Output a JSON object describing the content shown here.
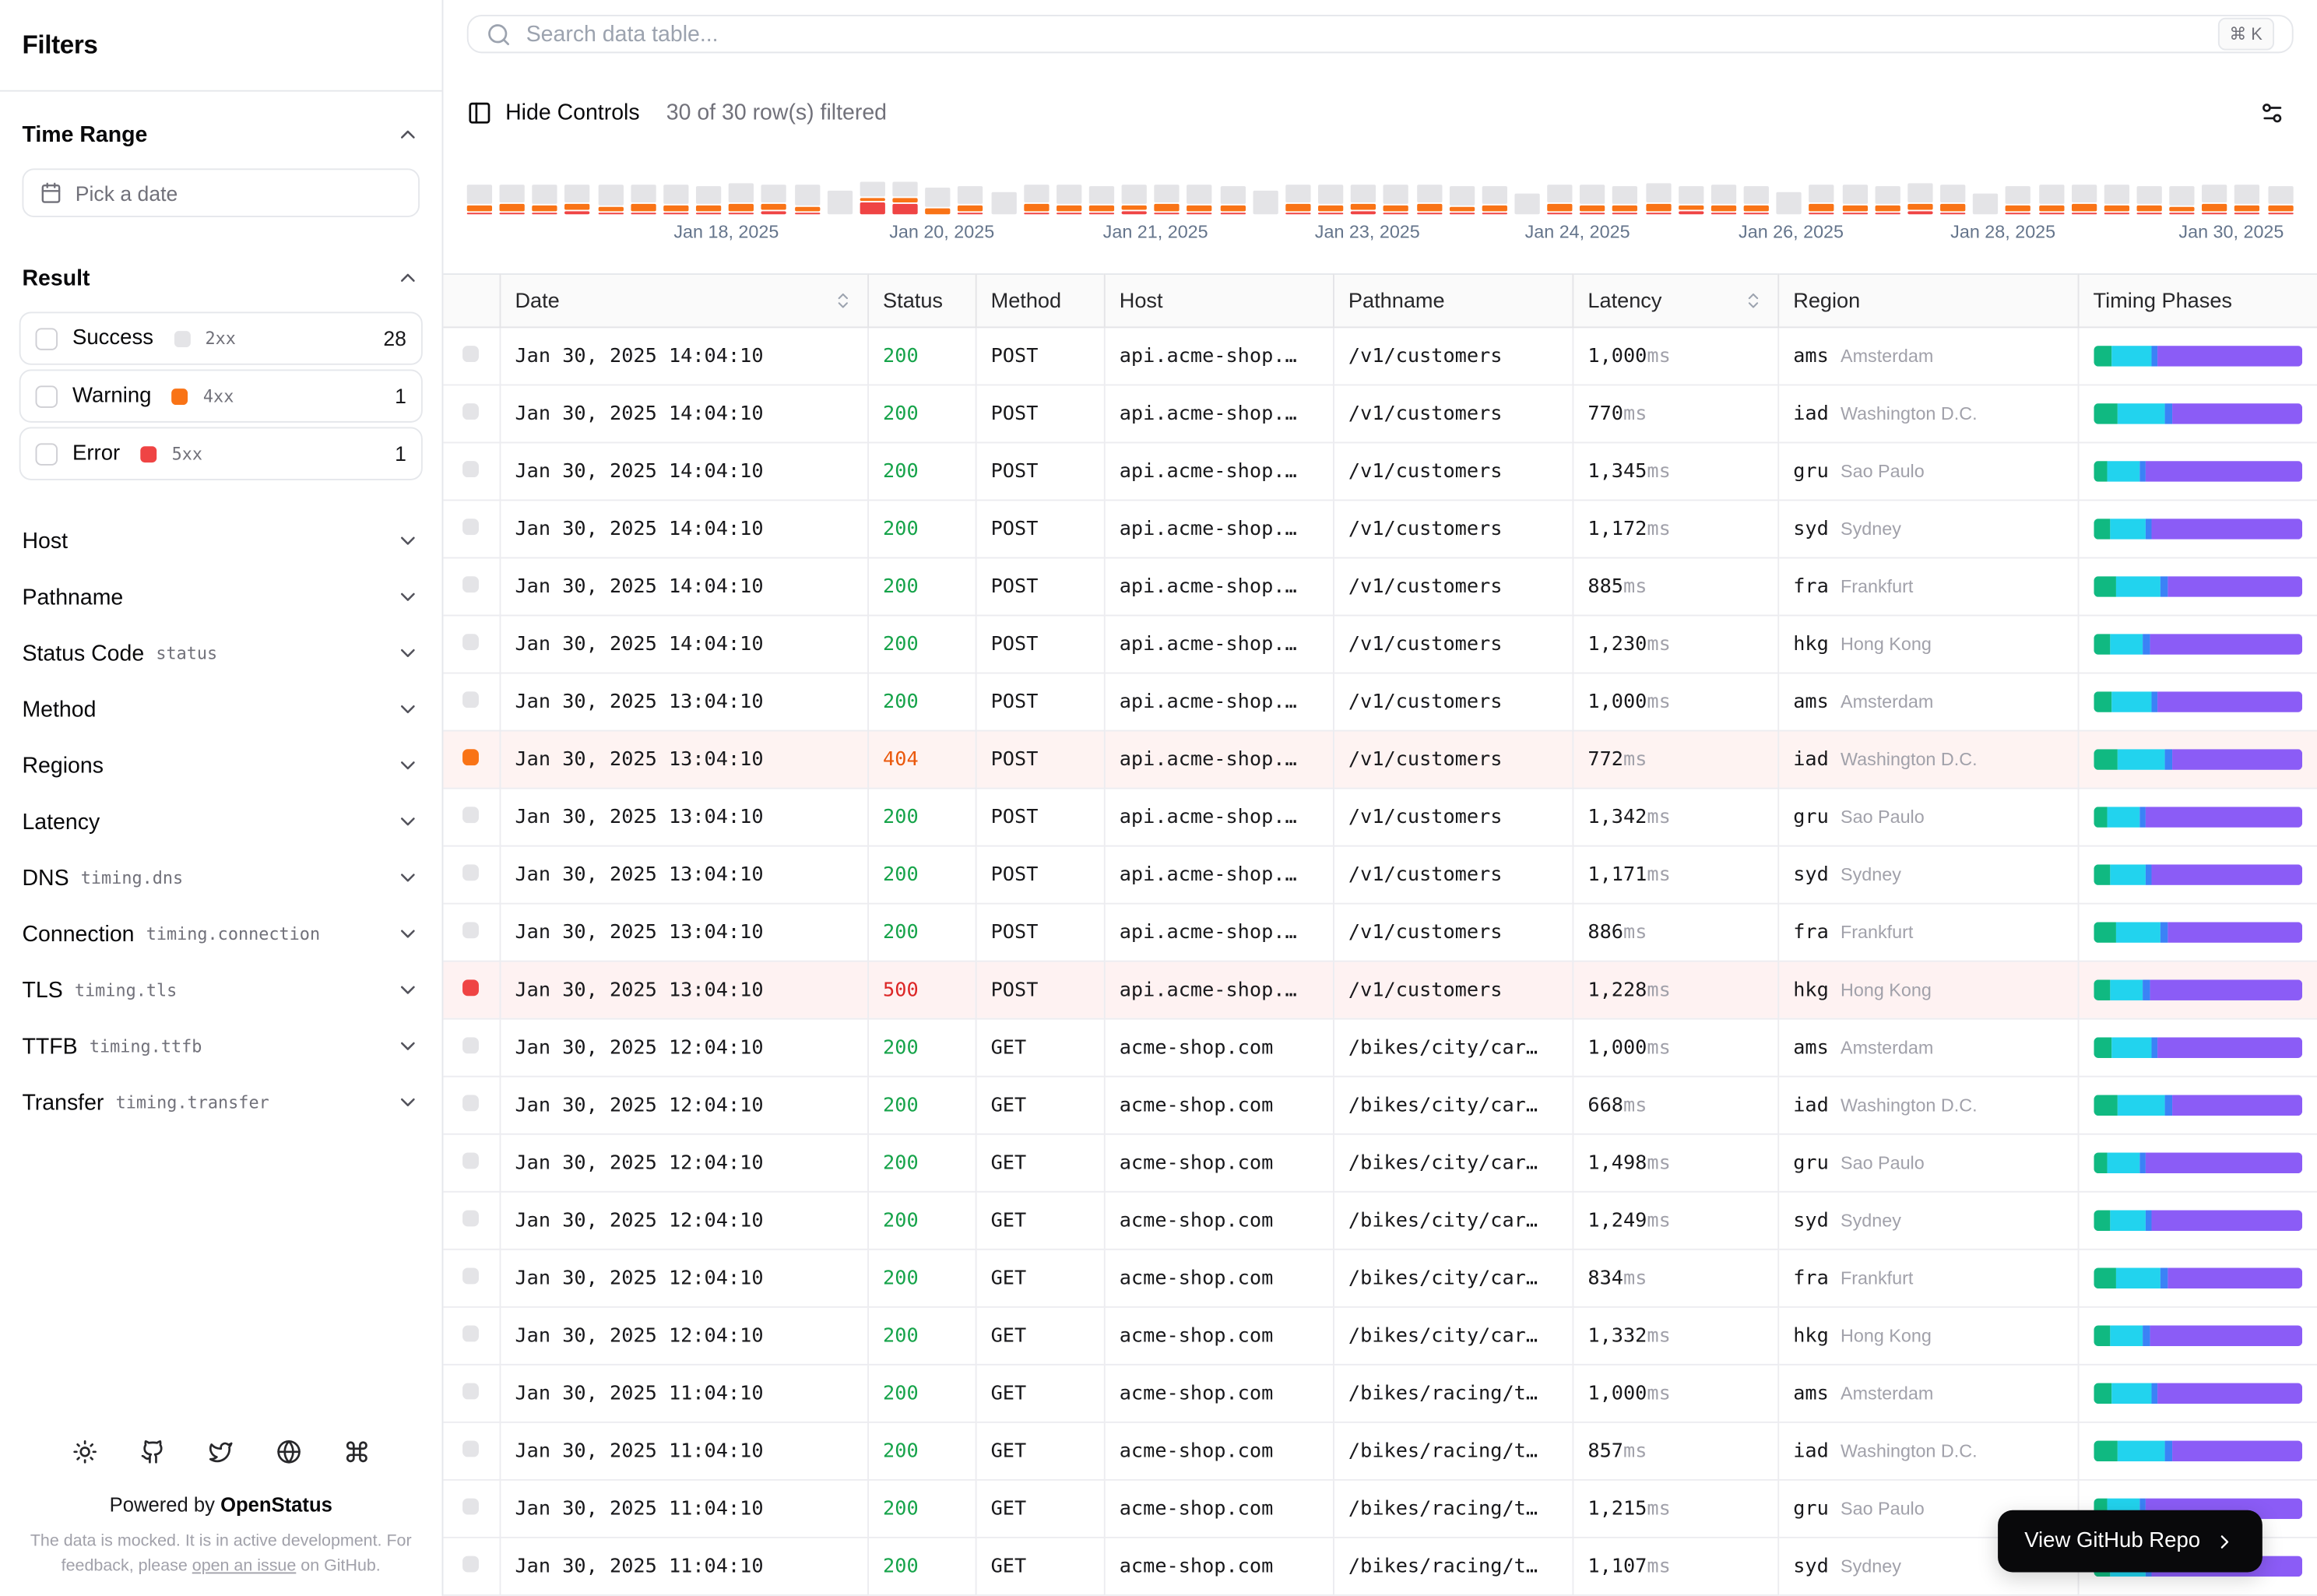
{
  "sidebar": {
    "title": "Filters",
    "time_range": {
      "label": "Time Range",
      "placeholder": "Pick a date"
    },
    "result": {
      "label": "Result",
      "options": [
        {
          "label": "Success",
          "code": "2xx",
          "count": "28",
          "color": "#e4e4e7"
        },
        {
          "label": "Warning",
          "code": "4xx",
          "count": "1",
          "color": "#f97316"
        },
        {
          "label": "Error",
          "code": "5xx",
          "count": "1",
          "color": "#ef4444"
        }
      ]
    },
    "collapsed_sections": [
      {
        "label": "Host",
        "code": ""
      },
      {
        "label": "Pathname",
        "code": ""
      },
      {
        "label": "Status Code",
        "code": "status"
      },
      {
        "label": "Method",
        "code": ""
      },
      {
        "label": "Regions",
        "code": ""
      },
      {
        "label": "Latency",
        "code": ""
      },
      {
        "label": "DNS",
        "code": "timing.dns"
      },
      {
        "label": "Connection",
        "code": "timing.connection"
      },
      {
        "label": "TLS",
        "code": "timing.tls"
      },
      {
        "label": "TTFB",
        "code": "timing.ttfb"
      },
      {
        "label": "Transfer",
        "code": "timing.transfer"
      }
    ],
    "footer": {
      "icons": [
        "sun-icon",
        "github-icon",
        "twitter-icon",
        "globe-icon",
        "command-icon"
      ],
      "powered_prefix": "Powered by ",
      "powered_link": "OpenStatus",
      "note_line1": "The data is mocked. It is in active development. For",
      "note_line2_prefix": "feedback, please ",
      "note_line2_link": "open an issue",
      "note_line2_suffix": " on GitHub."
    }
  },
  "toolbar": {
    "search_placeholder": "Search data table...",
    "kbd": "⌘ K",
    "hide_controls_label": "Hide Controls",
    "filtered_text": "30 of 30 row(s) filtered"
  },
  "chart_data": {
    "type": "bar",
    "stacked": true,
    "note": "request volume per time bucket; segment heights in px as rendered",
    "series_names": [
      "success",
      "warning",
      "error"
    ],
    "series_colors": {
      "success": "#e4e4e7",
      "warning": "#f97316",
      "error": "#ef4444"
    },
    "x_labels": [
      "Jan 18, 2025",
      "Jan 20, 2025",
      "Jan 21, 2025",
      "Jan 23, 2025",
      "Jan 24, 2025",
      "Jan 26, 2025",
      "Jan 28, 2025",
      "Jan 30, 2025"
    ],
    "x_label_positions_pct": [
      14.2,
      26.0,
      37.7,
      49.3,
      60.8,
      72.5,
      84.1,
      96.6
    ],
    "bars": [
      [
        13,
        4,
        1
      ],
      [
        12,
        5,
        1
      ],
      [
        13,
        4,
        1
      ],
      [
        12,
        4,
        2
      ],
      [
        14,
        3,
        1
      ],
      [
        12,
        5,
        1
      ],
      [
        13,
        4,
        1
      ],
      [
        12,
        4,
        1
      ],
      [
        13,
        5,
        1
      ],
      [
        12,
        4,
        2
      ],
      [
        14,
        3,
        1
      ],
      [
        16,
        0,
        0
      ],
      [
        10,
        2,
        8
      ],
      [
        10,
        3,
        7
      ],
      [
        13,
        4,
        0
      ],
      [
        12,
        4,
        1
      ],
      [
        15,
        0,
        0
      ],
      [
        12,
        5,
        1
      ],
      [
        13,
        4,
        1
      ],
      [
        12,
        4,
        1
      ],
      [
        13,
        3,
        2
      ],
      [
        12,
        5,
        1
      ],
      [
        13,
        4,
        1
      ],
      [
        12,
        4,
        1
      ],
      [
        16,
        0,
        0
      ],
      [
        12,
        5,
        1
      ],
      [
        13,
        4,
        1
      ],
      [
        12,
        4,
        2
      ],
      [
        13,
        4,
        1
      ],
      [
        12,
        5,
        1
      ],
      [
        13,
        3,
        1
      ],
      [
        12,
        4,
        1
      ],
      [
        14,
        0,
        0
      ],
      [
        12,
        5,
        1
      ],
      [
        13,
        4,
        1
      ],
      [
        12,
        4,
        1
      ],
      [
        13,
        5,
        1
      ],
      [
        12,
        3,
        2
      ],
      [
        13,
        4,
        1
      ],
      [
        12,
        4,
        1
      ],
      [
        15,
        0,
        0
      ],
      [
        12,
        5,
        1
      ],
      [
        13,
        4,
        1
      ],
      [
        12,
        4,
        1
      ],
      [
        13,
        4,
        2
      ],
      [
        12,
        5,
        1
      ],
      [
        14,
        0,
        0
      ],
      [
        12,
        4,
        1
      ],
      [
        13,
        4,
        1
      ],
      [
        12,
        5,
        1
      ],
      [
        13,
        4,
        1
      ],
      [
        12,
        4,
        1
      ],
      [
        13,
        3,
        1
      ],
      [
        12,
        5,
        1
      ],
      [
        13,
        4,
        1
      ],
      [
        12,
        4,
        1
      ]
    ]
  },
  "table": {
    "columns": [
      {
        "label": "",
        "key": "select",
        "sortable": false
      },
      {
        "label": "Date",
        "key": "date",
        "sortable": true
      },
      {
        "label": "Status",
        "key": "status",
        "sortable": false
      },
      {
        "label": "Method",
        "key": "method",
        "sortable": false
      },
      {
        "label": "Host",
        "key": "host",
        "sortable": false
      },
      {
        "label": "Pathname",
        "key": "pathname",
        "sortable": false
      },
      {
        "label": "Latency",
        "key": "latency",
        "sortable": true
      },
      {
        "label": "Region",
        "key": "region",
        "sortable": false
      },
      {
        "label": "Timing Phases",
        "key": "timing",
        "sortable": false
      }
    ],
    "status_colors": {
      "200": "#16a34a",
      "404": "#ea580c",
      "500": "#dc2626"
    },
    "level_colors": {
      "success": "#e4e4e7",
      "warning": "#f97316",
      "error": "#ef4444"
    },
    "timing_colors": [
      "#10b981",
      "#22d3ee",
      "#3b82f6",
      "#8b5cf6"
    ],
    "timing_phase_names": [
      "dns",
      "connection",
      "tls",
      "ttfb"
    ],
    "rows": [
      {
        "date": "Jan 30, 2025 14:04:10",
        "status": "200",
        "method": "POST",
        "host": "api.acme-shop.…",
        "path": "/v1/customers",
        "latency": "1,000",
        "region": "ams",
        "city": "Amsterdam",
        "level": "success",
        "timing": [
          9,
          19,
          3,
          69
        ]
      },
      {
        "date": "Jan 30, 2025 14:04:10",
        "status": "200",
        "method": "POST",
        "host": "api.acme-shop.…",
        "path": "/v1/customers",
        "latency": "770",
        "region": "iad",
        "city": "Washington D.C.",
        "level": "success",
        "timing": [
          12,
          22,
          4,
          62
        ]
      },
      {
        "date": "Jan 30, 2025 14:04:10",
        "status": "200",
        "method": "POST",
        "host": "api.acme-shop.…",
        "path": "/v1/customers",
        "latency": "1,345",
        "region": "gru",
        "city": "Sao Paulo",
        "level": "success",
        "timing": [
          7,
          15,
          3,
          75
        ]
      },
      {
        "date": "Jan 30, 2025 14:04:10",
        "status": "200",
        "method": "POST",
        "host": "api.acme-shop.…",
        "path": "/v1/customers",
        "latency": "1,172",
        "region": "syd",
        "city": "Sydney",
        "level": "success",
        "timing": [
          8,
          17,
          3,
          72
        ]
      },
      {
        "date": "Jan 30, 2025 14:04:10",
        "status": "200",
        "method": "POST",
        "host": "api.acme-shop.…",
        "path": "/v1/customers",
        "latency": "885",
        "region": "fra",
        "city": "Frankfurt",
        "level": "success",
        "timing": [
          11,
          21,
          4,
          64
        ]
      },
      {
        "date": "Jan 30, 2025 14:04:10",
        "status": "200",
        "method": "POST",
        "host": "api.acme-shop.…",
        "path": "/v1/customers",
        "latency": "1,230",
        "region": "hkg",
        "city": "Hong Kong",
        "level": "success",
        "timing": [
          8,
          16,
          3,
          73
        ]
      },
      {
        "date": "Jan 30, 2025 13:04:10",
        "status": "200",
        "method": "POST",
        "host": "api.acme-shop.…",
        "path": "/v1/customers",
        "latency": "1,000",
        "region": "ams",
        "city": "Amsterdam",
        "level": "success",
        "timing": [
          9,
          19,
          3,
          69
        ]
      },
      {
        "date": "Jan 30, 2025 13:04:10",
        "status": "404",
        "method": "POST",
        "host": "api.acme-shop.…",
        "path": "/v1/customers",
        "latency": "772",
        "region": "iad",
        "city": "Washington D.C.",
        "level": "warning",
        "timing": [
          12,
          22,
          4,
          62
        ]
      },
      {
        "date": "Jan 30, 2025 13:04:10",
        "status": "200",
        "method": "POST",
        "host": "api.acme-shop.…",
        "path": "/v1/customers",
        "latency": "1,342",
        "region": "gru",
        "city": "Sao Paulo",
        "level": "success",
        "timing": [
          7,
          15,
          3,
          75
        ]
      },
      {
        "date": "Jan 30, 2025 13:04:10",
        "status": "200",
        "method": "POST",
        "host": "api.acme-shop.…",
        "path": "/v1/customers",
        "latency": "1,171",
        "region": "syd",
        "city": "Sydney",
        "level": "success",
        "timing": [
          8,
          17,
          3,
          72
        ]
      },
      {
        "date": "Jan 30, 2025 13:04:10",
        "status": "200",
        "method": "POST",
        "host": "api.acme-shop.…",
        "path": "/v1/customers",
        "latency": "886",
        "region": "fra",
        "city": "Frankfurt",
        "level": "success",
        "timing": [
          11,
          21,
          4,
          64
        ]
      },
      {
        "date": "Jan 30, 2025 13:04:10",
        "status": "500",
        "method": "POST",
        "host": "api.acme-shop.…",
        "path": "/v1/customers",
        "latency": "1,228",
        "region": "hkg",
        "city": "Hong Kong",
        "level": "error",
        "timing": [
          8,
          16,
          3,
          73
        ]
      },
      {
        "date": "Jan 30, 2025 12:04:10",
        "status": "200",
        "method": "GET",
        "host": "acme-shop.com",
        "path": "/bikes/city/car…",
        "latency": "1,000",
        "region": "ams",
        "city": "Amsterdam",
        "level": "success",
        "timing": [
          9,
          19,
          3,
          69
        ]
      },
      {
        "date": "Jan 30, 2025 12:04:10",
        "status": "200",
        "method": "GET",
        "host": "acme-shop.com",
        "path": "/bikes/city/car…",
        "latency": "668",
        "region": "iad",
        "city": "Washington D.C.",
        "level": "success",
        "timing": [
          12,
          22,
          4,
          62
        ]
      },
      {
        "date": "Jan 30, 2025 12:04:10",
        "status": "200",
        "method": "GET",
        "host": "acme-shop.com",
        "path": "/bikes/city/car…",
        "latency": "1,498",
        "region": "gru",
        "city": "Sao Paulo",
        "level": "success",
        "timing": [
          7,
          15,
          3,
          75
        ]
      },
      {
        "date": "Jan 30, 2025 12:04:10",
        "status": "200",
        "method": "GET",
        "host": "acme-shop.com",
        "path": "/bikes/city/car…",
        "latency": "1,249",
        "region": "syd",
        "city": "Sydney",
        "level": "success",
        "timing": [
          8,
          17,
          3,
          72
        ]
      },
      {
        "date": "Jan 30, 2025 12:04:10",
        "status": "200",
        "method": "GET",
        "host": "acme-shop.com",
        "path": "/bikes/city/car…",
        "latency": "834",
        "region": "fra",
        "city": "Frankfurt",
        "level": "success",
        "timing": [
          11,
          21,
          4,
          64
        ]
      },
      {
        "date": "Jan 30, 2025 12:04:10",
        "status": "200",
        "method": "GET",
        "host": "acme-shop.com",
        "path": "/bikes/city/car…",
        "latency": "1,332",
        "region": "hkg",
        "city": "Hong Kong",
        "level": "success",
        "timing": [
          8,
          16,
          3,
          73
        ]
      },
      {
        "date": "Jan 30, 2025 11:04:10",
        "status": "200",
        "method": "GET",
        "host": "acme-shop.com",
        "path": "/bikes/racing/t…",
        "latency": "1,000",
        "region": "ams",
        "city": "Amsterdam",
        "level": "success",
        "timing": [
          9,
          19,
          3,
          69
        ]
      },
      {
        "date": "Jan 30, 2025 11:04:10",
        "status": "200",
        "method": "GET",
        "host": "acme-shop.com",
        "path": "/bikes/racing/t…",
        "latency": "857",
        "region": "iad",
        "city": "Washington D.C.",
        "level": "success",
        "timing": [
          12,
          22,
          4,
          62
        ]
      },
      {
        "date": "Jan 30, 2025 11:04:10",
        "status": "200",
        "method": "GET",
        "host": "acme-shop.com",
        "path": "/bikes/racing/t…",
        "latency": "1,215",
        "region": "gru",
        "city": "Sao Paulo",
        "level": "success",
        "timing": [
          7,
          15,
          3,
          75
        ]
      },
      {
        "date": "Jan 30, 2025 11:04:10",
        "status": "200",
        "method": "GET",
        "host": "acme-shop.com",
        "path": "/bikes/racing/t…",
        "latency": "1,107",
        "region": "syd",
        "city": "Sydney",
        "level": "success",
        "timing": [
          8,
          17,
          3,
          72
        ]
      }
    ]
  },
  "github_button": {
    "label": "View GitHub Repo"
  }
}
